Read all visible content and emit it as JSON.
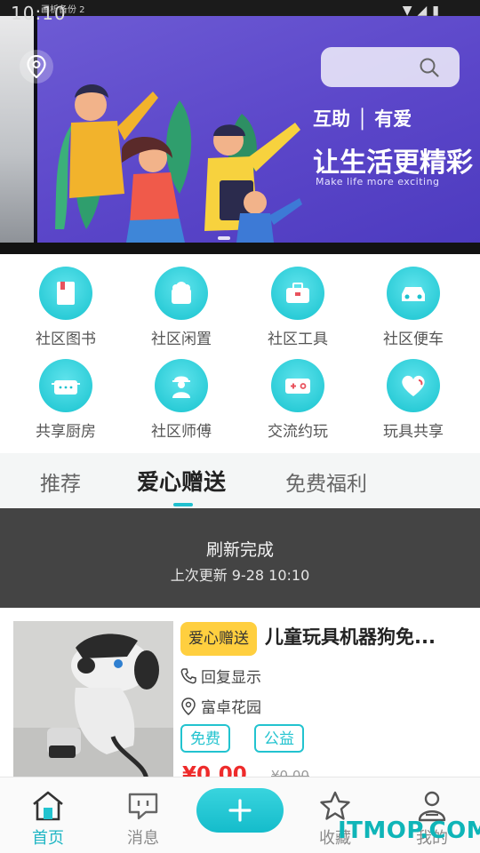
{
  "status_bar": {
    "time": "10:10",
    "note": "画析备份 2"
  },
  "banner": {
    "title_a": "互助 │ 有爱",
    "title_b": "让生活更精彩",
    "subtitle": "Make life more exciting"
  },
  "categories": [
    {
      "label": "社区图书",
      "icon": "book-icon"
    },
    {
      "label": "社区闲置",
      "icon": "idle-bag-icon"
    },
    {
      "label": "社区工具",
      "icon": "toolbox-icon"
    },
    {
      "label": "社区便车",
      "icon": "car-icon"
    },
    {
      "label": "共享厨房",
      "icon": "pot-icon"
    },
    {
      "label": "社区师傅",
      "icon": "worker-icon"
    },
    {
      "label": "交流约玩",
      "icon": "game-icon"
    },
    {
      "label": "玩具共享",
      "icon": "heart-icon"
    }
  ],
  "tabs": [
    "推荐",
    "爱心赠送",
    "免费福利"
  ],
  "active_tab": "爱心赠送",
  "refresh": {
    "title": "刷新完成",
    "time": "上次更新 9-28 10:10"
  },
  "item": {
    "tag": "爱心赠送",
    "title": "儿童玩具机器狗免...",
    "reply": "回复显示",
    "location": "富卓花园",
    "tags": [
      "免费",
      "公益"
    ],
    "price": "¥0.00",
    "old_price": "¥0.00"
  },
  "nav": {
    "home": "首页",
    "messages": "消息",
    "favorites": "收藏",
    "mine": "我的"
  },
  "watermark": "ITMOP.COM",
  "colors": {
    "accent": "#20c0cf",
    "price": "#ee2b2b",
    "tag": "#ffcf3f"
  }
}
